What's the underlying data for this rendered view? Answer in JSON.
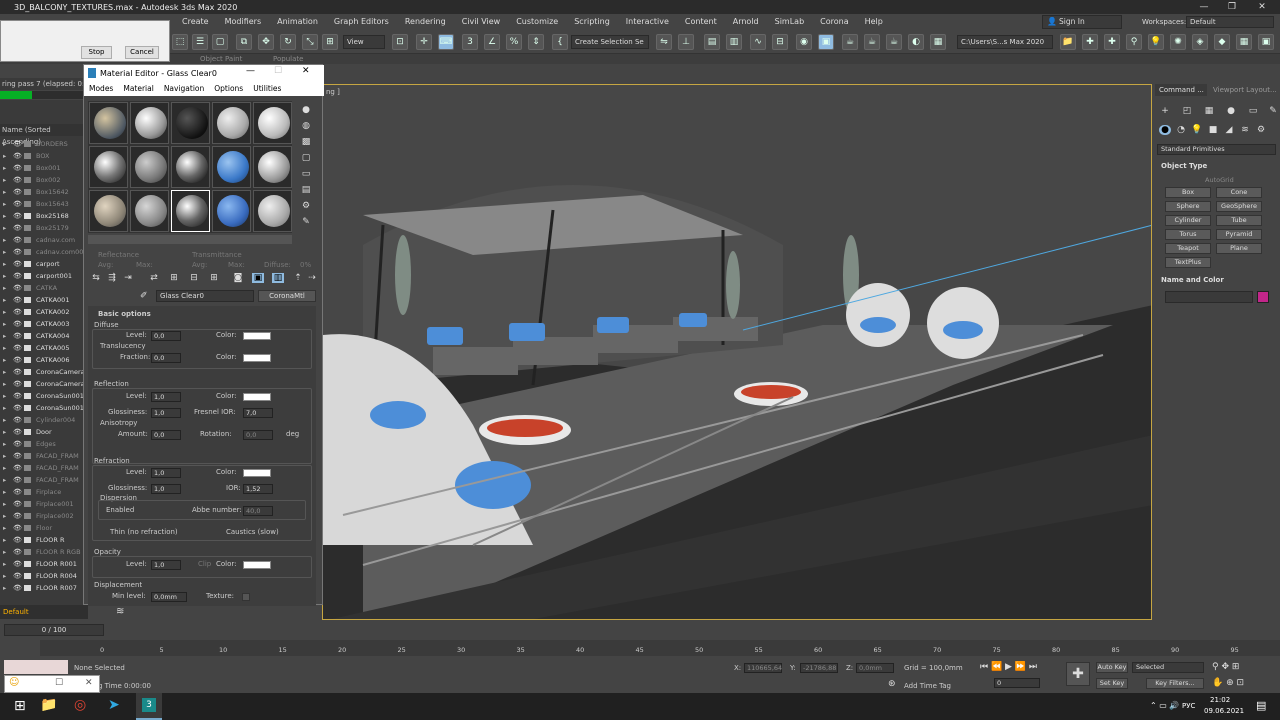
{
  "window": {
    "title": "3D_BALCONY_TEXTURES.max - Autodesk 3ds Max 2020",
    "minimize": "—",
    "maximize": "❐",
    "close": "✕"
  },
  "menubar": [
    "Create",
    "Modifiers",
    "Animation",
    "Graph Editors",
    "Rendering",
    "Civil View",
    "Customize",
    "Scripting",
    "Interactive",
    "Content",
    "Arnold",
    "SimLab",
    "Corona",
    "Help"
  ],
  "account": {
    "sign_in": "Sign In",
    "workspaces_label": "Workspaces:",
    "workspace": "Default"
  },
  "toolbar": {
    "view_dropdown": "View",
    "selection_set": "Create Selection Se",
    "path": "C:\\Users\\S...s Max 2020"
  },
  "ribbon": {
    "object_paint": "Object Paint",
    "populate": "Populate"
  },
  "render_dialog": {
    "stop": "Stop",
    "cancel": "Cancel",
    "pass": "ring pass 7 (elapsed: 0:01"
  },
  "scene_explorer": {
    "header": "Name (Sorted Ascending)",
    "rows": [
      {
        "name": "BORDERS",
        "dim": true
      },
      {
        "name": "BOX",
        "dim": true
      },
      {
        "name": "Box001",
        "dim": true
      },
      {
        "name": "Box002",
        "dim": true
      },
      {
        "name": "Box15642",
        "dim": true
      },
      {
        "name": "Box15643",
        "dim": true
      },
      {
        "name": "Box25168",
        "dim": false
      },
      {
        "name": "Box25179",
        "dim": true
      },
      {
        "name": "cadnav.com",
        "dim": true
      },
      {
        "name": "cadnav.com00",
        "dim": true
      },
      {
        "name": "carport",
        "dim": false
      },
      {
        "name": "carport001",
        "dim": false
      },
      {
        "name": "CATKA",
        "dim": true
      },
      {
        "name": "CATKA001",
        "dim": false
      },
      {
        "name": "CATKA002",
        "dim": false
      },
      {
        "name": "CATKA003",
        "dim": false
      },
      {
        "name": "CATKA004",
        "dim": false
      },
      {
        "name": "CATKA005",
        "dim": false
      },
      {
        "name": "CATKA006",
        "dim": false
      },
      {
        "name": "CoronaCamera",
        "dim": false
      },
      {
        "name": "CoronaCamera",
        "dim": false
      },
      {
        "name": "CoronaSun001",
        "dim": false
      },
      {
        "name": "CoronaSun001",
        "dim": false
      },
      {
        "name": "Cylinder004",
        "dim": true
      },
      {
        "name": "Door",
        "dim": false
      },
      {
        "name": "Edges",
        "dim": true
      },
      {
        "name": "FACAD_FRAM",
        "dim": true
      },
      {
        "name": "FACAD_FRAM",
        "dim": true
      },
      {
        "name": "FACAD_FRAM",
        "dim": true
      },
      {
        "name": "Firplace",
        "dim": true
      },
      {
        "name": "Firplace001",
        "dim": true
      },
      {
        "name": "Firplace002",
        "dim": true
      },
      {
        "name": "Floor",
        "dim": true
      },
      {
        "name": "FLOOR R",
        "dim": false
      },
      {
        "name": "FLOOR R RGB",
        "dim": true
      },
      {
        "name": "FLOOR R001",
        "dim": false
      },
      {
        "name": "FLOOR R004",
        "dim": false
      },
      {
        "name": "FLOOR R007",
        "dim": false
      }
    ],
    "layer": "Default"
  },
  "material_editor": {
    "title": "Material Editor - Glass Clear0",
    "menu": [
      "Modes",
      "Material",
      "Navigation",
      "Options",
      "Utilities"
    ],
    "reflectance": "Reflectance",
    "transmittance": "Transmittance",
    "avg": "Avg:",
    "max": "Max:",
    "diffuse_short": "Diffuse:",
    "diffuse_pct": "0%",
    "material_name": "Glass Clear0",
    "material_type": "CoronaMtl",
    "basic_options": "Basic options",
    "diffuse": {
      "label": "Diffuse",
      "level_label": "Level:",
      "level": "0,0",
      "color_label": "Color:"
    },
    "translucency": {
      "label": "Translucency",
      "fraction_label": "Fraction:",
      "fraction": "0,0",
      "color_label": "Color:"
    },
    "reflection": {
      "label": "Reflection",
      "level_label": "Level:",
      "level": "1,0",
      "color_label": "Color:",
      "gloss_label": "Glossiness:",
      "gloss": "1,0",
      "fresnel_label": "Fresnel IOR:",
      "fresnel": "7,0"
    },
    "anisotropy": {
      "label": "Anisotropy",
      "amount_label": "Amount:",
      "amount": "0,0",
      "rotation_label": "Rotation:",
      "rotation": "0,0",
      "unit": "deg"
    },
    "refraction": {
      "label": "Refraction",
      "level_label": "Level:",
      "level": "1,0",
      "color_label": "Color:",
      "gloss_label": "Glossiness:",
      "gloss": "1,0",
      "ior_label": "IOR:",
      "ior": "1,52"
    },
    "dispersion": {
      "label": "Dispersion",
      "enabled": "Enabled",
      "abbe_label": "Abbe number:",
      "abbe": "40,0"
    },
    "thin": "Thin (no refraction)",
    "caustics": "Caustics (slow)",
    "opacity": {
      "label": "Opacity",
      "level_label": "Level:",
      "level": "1,0",
      "clip": "Clip",
      "color_label": "Color:"
    },
    "displacement": {
      "label": "Displacement",
      "min_label": "Min level:",
      "min": "0,0mm",
      "texture_label": "Texture:"
    }
  },
  "viewport": {
    "label": "ng ]"
  },
  "command_panel": {
    "tabs": [
      "Command ...",
      "Viewport Layout..."
    ],
    "category": "Standard Primitives",
    "object_type": "Object Type",
    "autogrid": "AutoGrid",
    "buttons": [
      "Box",
      "Cone",
      "Sphere",
      "GeoSphere",
      "Cylinder",
      "Tube",
      "Torus",
      "Pyramid",
      "Teapot",
      "Plane",
      "TextPlus"
    ],
    "name_color": "Name and Color",
    "swatch_color": "#c2268a"
  },
  "timeline": {
    "frame": "0 / 100",
    "ticks": [
      "0",
      "5",
      "10",
      "15",
      "20",
      "25",
      "30",
      "35",
      "40",
      "45",
      "50",
      "55",
      "60",
      "65",
      "70",
      "75",
      "80",
      "85",
      "90",
      "95",
      "100"
    ]
  },
  "status": {
    "selected": "None Selected",
    "anim_time": "g Time  0:00:00",
    "x_label": "X:",
    "x": "110665,64",
    "y_label": "Y:",
    "y": "-21786,88",
    "z_label": "Z:",
    "z": "0,0mm",
    "grid": "Grid = 100,0mm",
    "add_time_tag": "Add Time Tag",
    "auto_key": "Auto Key",
    "set_key": "Set Key",
    "selected_dd": "Selected",
    "key_filters": "Key Filters...",
    "frame_field": "0"
  },
  "taskbar": {
    "lang": "РУС",
    "time": "21:02",
    "date": "09.06.2021"
  }
}
